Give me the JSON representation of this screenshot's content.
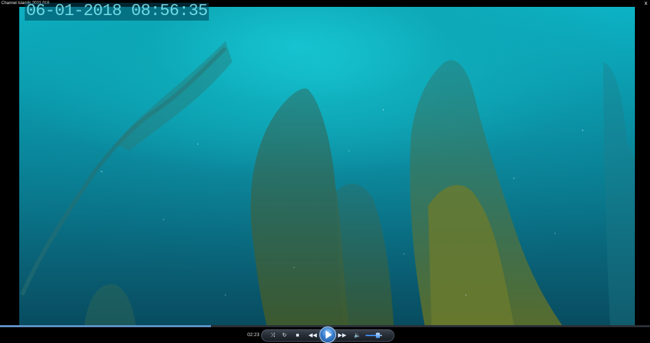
{
  "window": {
    "title": "Channel Islands 2021 018",
    "close_glyph": "x"
  },
  "video": {
    "timestamp_overlay": "06-01-2018  08:56:35",
    "description_colors": {
      "water_top": "#0cb6c8",
      "water_bottom": "#084c60",
      "kelp": "#4f6a3a"
    }
  },
  "player": {
    "elapsed": "02:23",
    "seek_progress_fraction": 0.325,
    "volume_fraction": 0.75,
    "controls": {
      "shuffle_icon": "shuffle-icon",
      "repeat_icon": "repeat-icon",
      "stop_icon": "stop-icon",
      "previous_icon": "previous-icon",
      "play_icon": "play-icon",
      "next_icon": "next-icon",
      "volume_icon": "volume-icon"
    },
    "accent_color": "#3a7fcf"
  }
}
